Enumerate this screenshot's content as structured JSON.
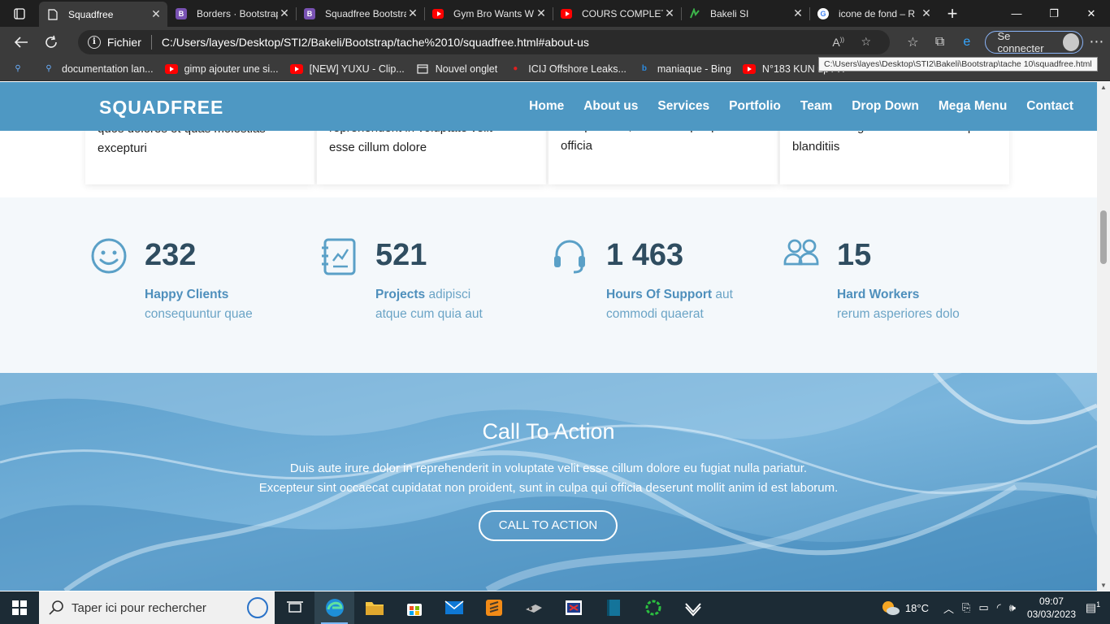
{
  "browser": {
    "tabs": [
      {
        "label": "Squadfree",
        "active": true,
        "icon": "page-icon"
      },
      {
        "label": "Borders · Bootstrap",
        "icon": "bootstrap-icon"
      },
      {
        "label": "Squadfree Bootstrap",
        "icon": "bootstrap-icon"
      },
      {
        "label": "Gym Bro Wants W",
        "icon": "youtube-icon"
      },
      {
        "label": "COURS COMPLET",
        "icon": "youtube-icon"
      },
      {
        "label": "Bakeli SI",
        "icon": "bakeli-icon"
      },
      {
        "label": "icone de fond – R",
        "icon": "google-icon"
      }
    ],
    "address": {
      "scheme_label": "Fichier",
      "url": "C:/Users/layes/Desktop/STI2/Bakeli/Bootstrap/tache%2010/squadfree.html#about-us"
    },
    "signin_label": "Se connecter",
    "tooltip": "C:\\Users\\layes\\Desktop\\STI2\\Bakeli\\Bootstrap\\tache 10\\squadfree.html",
    "favorites": [
      {
        "label": "documentation lan...",
        "icon": "search-icon"
      },
      {
        "label": "gimp ajouter une si...",
        "icon": "youtube-icon"
      },
      {
        "label": "[NEW] YUXU - Clip...",
        "icon": "youtube-icon"
      },
      {
        "label": "Nouvel onglet",
        "icon": "tab-icon"
      },
      {
        "label": "ICIJ Offshore Leaks...",
        "icon": "icij-icon"
      },
      {
        "label": "maniaque - Bing",
        "icon": "bing-icon"
      },
      {
        "label": "N°183 KUN up / H",
        "icon": "youtube-icon"
      }
    ]
  },
  "site": {
    "brand": "SQUADFREE",
    "menu": [
      "Home",
      "About us",
      "Services",
      "Portfolio",
      "Team",
      "Drop Down",
      "Mega Menu",
      "Contact"
    ],
    "cards": [
      {
        "line1": "quos dolores et quas molestias",
        "line2": "excepturi"
      },
      {
        "line1": "reprehenderit in voluptate velit",
        "line2": "esse cillum dolore"
      },
      {
        "line1": "non proident, sunt in culpa qui",
        "line2": "officia"
      },
      {
        "line1": "iusto odio dignissimos ducimus qui",
        "line2": "blanditiis"
      }
    ],
    "counters": [
      {
        "icon": "smile-icon",
        "number": "232",
        "title": "Happy Clients",
        "text1": "",
        "text2": "consequuntur quae"
      },
      {
        "icon": "journal-icon",
        "number": "521",
        "title": "Projects",
        "text1": "adipisci",
        "text2": "atque cum quia aut"
      },
      {
        "icon": "headset-icon",
        "number": "1 463",
        "title": "Hours Of Support",
        "text1": "aut",
        "text2": "commodi quaerat"
      },
      {
        "icon": "people-icon",
        "number": "15",
        "title": "Hard Workers",
        "text1": "",
        "text2": "rerum asperiores dolo"
      }
    ],
    "cta": {
      "title": "Call To Action",
      "line1": "Duis aute irure dolor in reprehenderit in voluptate velit esse cillum dolore eu fugiat nulla pariatur.",
      "line2": "Excepteur sint occaecat cupidatat non proident, sunt in culpa qui officia deserunt mollit anim id est laborum.",
      "button": "Call To Action"
    }
  },
  "taskbar": {
    "search_placeholder": "Taper ici pour rechercher",
    "temperature": "18°C",
    "time": "09:07",
    "date": "03/03/2023",
    "notifications": "1"
  },
  "colors": {
    "navbar": "#4e98c3",
    "counter_bg": "#f4f8fb",
    "counter_number": "#2f4d60",
    "counter_text": "#6ba4c6",
    "icon_blue": "#5aa0c7",
    "cta_bg": "#6aa9d3"
  }
}
